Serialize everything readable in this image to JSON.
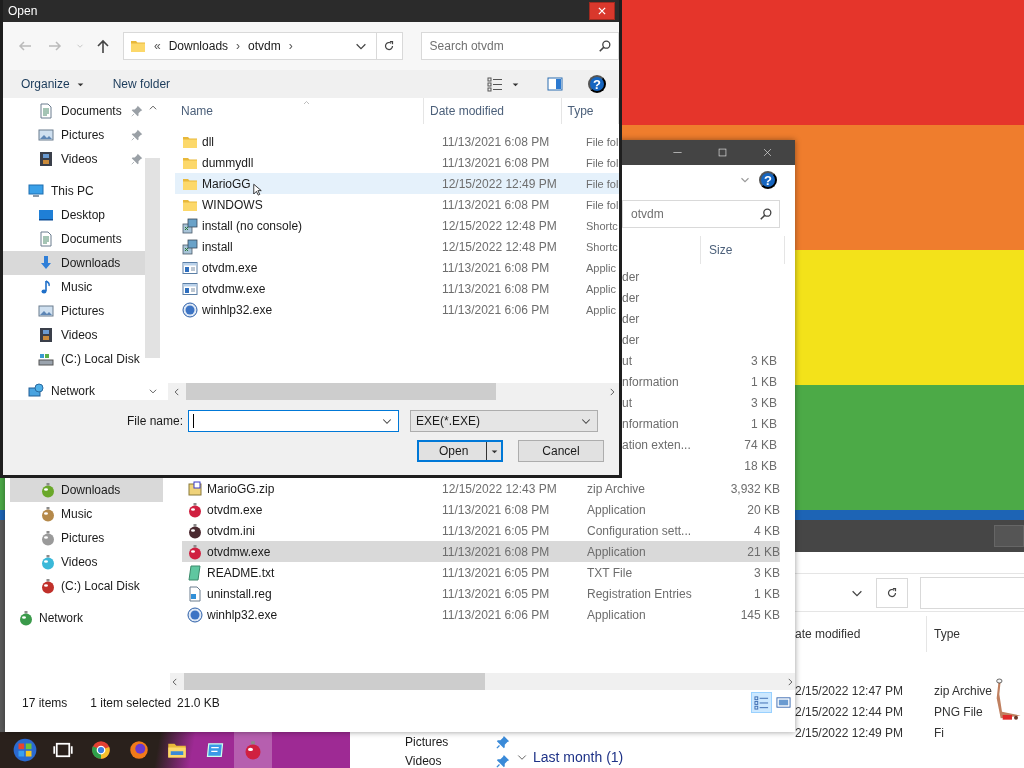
{
  "open_dialog": {
    "title": "Open",
    "breadcrumb": [
      {
        "text": "«",
        "kind": "overflow"
      },
      {
        "text": "Downloads",
        "kind": "segment"
      },
      {
        "text": "›",
        "kind": "separator"
      },
      {
        "text": "otvdm",
        "kind": "segment"
      },
      {
        "text": "›",
        "kind": "separator"
      }
    ],
    "search": {
      "placeholder": "Search otvdm"
    },
    "toolbar": [
      {
        "label": "Organize",
        "menu": true
      },
      {
        "label": "New folder",
        "menu": false
      }
    ],
    "help": "?",
    "nav": [
      {
        "kind": "group",
        "children": [
          {
            "label": "Documents",
            "kind": "documents",
            "pinned": true,
            "selected": false
          },
          {
            "label": "Pictures",
            "kind": "pictures",
            "pinned": true,
            "selected": false
          },
          {
            "label": "Videos",
            "kind": "videos",
            "pinned": true,
            "selected": false
          }
        ]
      },
      {
        "label": "This PC",
        "kind": "pc",
        "pinned": false,
        "selected": false,
        "children": [
          {
            "label": "Desktop",
            "kind": "desktop",
            "pinned": false,
            "selected": false
          },
          {
            "label": "Documents",
            "kind": "documents",
            "pinned": false,
            "selected": false
          },
          {
            "label": "Downloads",
            "kind": "downloads",
            "pinned": false,
            "selected": true
          },
          {
            "label": "Music",
            "kind": "music",
            "pinned": false,
            "selected": false
          },
          {
            "label": "Pictures",
            "kind": "pictures",
            "pinned": false,
            "selected": false
          },
          {
            "label": "Videos",
            "kind": "videos",
            "pinned": false,
            "selected": false
          },
          {
            "label": "(C:) Local Disk",
            "kind": "disk",
            "pinned": false,
            "selected": false
          }
        ]
      },
      {
        "label": "Network",
        "kind": "network",
        "pinned": false,
        "selected": false
      }
    ],
    "columns": [
      "Name",
      "Date modified",
      "Type"
    ],
    "files": [
      {
        "name": "dll",
        "date": "11/13/2021 6:08 PM",
        "type": "File fol",
        "kind": "folder",
        "hovered": false
      },
      {
        "name": "dummydll",
        "date": "11/13/2021 6:08 PM",
        "type": "File fol",
        "kind": "folder",
        "hovered": false
      },
      {
        "name": "MarioGG",
        "date": "12/15/2022 12:49 PM",
        "type": "File fol",
        "kind": "folder",
        "hovered": true
      },
      {
        "name": "WINDOWS",
        "date": "11/13/2021 6:08 PM",
        "type": "File fol",
        "kind": "folder",
        "hovered": false
      },
      {
        "name": "install (no console)",
        "date": "12/15/2022 12:48 PM",
        "type": "Shortc",
        "kind": "shortcut",
        "hovered": false
      },
      {
        "name": "install",
        "date": "12/15/2022 12:48 PM",
        "type": "Shortc",
        "kind": "shortcut",
        "hovered": false
      },
      {
        "name": "otvdm.exe",
        "date": "11/13/2021 6:08 PM",
        "type": "Applic",
        "kind": "app",
        "hovered": false
      },
      {
        "name": "otvdmw.exe",
        "date": "11/13/2021 6:08 PM",
        "type": "Applic",
        "kind": "app",
        "hovered": false
      },
      {
        "name": "winhlp32.exe",
        "date": "11/13/2021 6:06 PM",
        "type": "Applic",
        "kind": "help",
        "hovered": false
      }
    ],
    "file_name": {
      "label": "File name:",
      "focused": true
    },
    "filter": "EXE(*.EXE)",
    "buttons": [
      {
        "label": "Open",
        "kind": "split",
        "default": true
      },
      {
        "label": "Cancel",
        "kind": "plain",
        "default": false
      }
    ]
  },
  "explorer": {
    "help": "?",
    "search": {
      "placeholder": "otvdm"
    },
    "columns": [
      "Size"
    ],
    "hidden_rows": [
      {
        "type": "der"
      },
      {
        "type": "der"
      },
      {
        "type": "der"
      },
      {
        "type": "der"
      },
      {
        "type": "ut",
        "size": "3 KB"
      },
      {
        "type": "nformation",
        "size": "1 KB"
      },
      {
        "type": "ut",
        "size": "3 KB"
      },
      {
        "type": "nformation",
        "size": "1 KB"
      },
      {
        "type": "ation exten...",
        "size": "74 KB"
      },
      {
        "size": "18 KB"
      }
    ],
    "nav": [
      {
        "kind": "group",
        "children": [
          {
            "label": "Downloads",
            "kind": "downloads",
            "selected": true
          },
          {
            "label": "Music",
            "kind": "music",
            "selected": false
          },
          {
            "label": "Pictures",
            "kind": "pictures",
            "selected": false
          },
          {
            "label": "Videos",
            "kind": "videos",
            "selected": false
          },
          {
            "label": "(C:) Local Disk",
            "kind": "disk",
            "selected": false
          }
        ]
      },
      {
        "label": "Network",
        "kind": "network",
        "selected": false
      }
    ],
    "files": [
      {
        "name": "MarioGG.zip",
        "date": "12/15/2022 12:43 PM",
        "type": "zip Archive",
        "size": "3,932 KB",
        "kind": "zip",
        "selected": false
      },
      {
        "name": "otvdm.exe",
        "date": "11/13/2021 6:08 PM",
        "type": "Application",
        "size": "20 KB",
        "kind": "exe",
        "selected": false
      },
      {
        "name": "otvdm.ini",
        "date": "11/13/2021 6:05 PM",
        "type": "Configuration sett...",
        "size": "4 KB",
        "kind": "ini",
        "selected": false
      },
      {
        "name": "otvdmw.exe",
        "date": "11/13/2021 6:08 PM",
        "type": "Application",
        "size": "21 KB",
        "kind": "exe",
        "selected": true
      },
      {
        "name": "README.txt",
        "date": "11/13/2021 6:05 PM",
        "type": "TXT File",
        "size": "3 KB",
        "kind": "txt",
        "selected": false
      },
      {
        "name": "uninstall.reg",
        "date": "11/13/2021 6:05 PM",
        "type": "Registration Entries",
        "size": "1 KB",
        "kind": "reg",
        "selected": false
      },
      {
        "name": "winhlp32.exe",
        "date": "11/13/2021 6:06 PM",
        "type": "Application",
        "size": "145 KB",
        "kind": "help",
        "selected": false
      }
    ],
    "status": {
      "count": "17 items",
      "selection": "1 item selected",
      "size": "21.0 KB"
    },
    "views": [
      {
        "kind": "details",
        "selected": true
      },
      {
        "kind": "thumbnails",
        "selected": false
      }
    ]
  },
  "back_window": {
    "quick_access": [
      {
        "label": "Pictures",
        "pinned": true
      },
      {
        "label": "Videos",
        "pinned": true
      }
    ],
    "group": {
      "label": "Last month (1)",
      "expanded": true
    }
  },
  "right_window": {
    "columns": [
      "ate modified",
      "Type"
    ],
    "rows": [
      {
        "date": "2/15/2022 12:47 PM",
        "type": "zip Archive"
      },
      {
        "date": "2/15/2022 12:44 PM",
        "type": "PNG File"
      },
      {
        "date": "2/15/2022 12:49 PM",
        "type": "Fi"
      }
    ]
  },
  "taskbar": [
    {
      "kind": "start",
      "active": false
    },
    {
      "kind": "taskview",
      "active": false
    },
    {
      "kind": "browser",
      "active": false
    },
    {
      "kind": "fox",
      "active": false
    },
    {
      "kind": "explorer",
      "active": false
    },
    {
      "kind": "blueapp",
      "active": false
    },
    {
      "kind": "otvdm",
      "active": true
    }
  ]
}
